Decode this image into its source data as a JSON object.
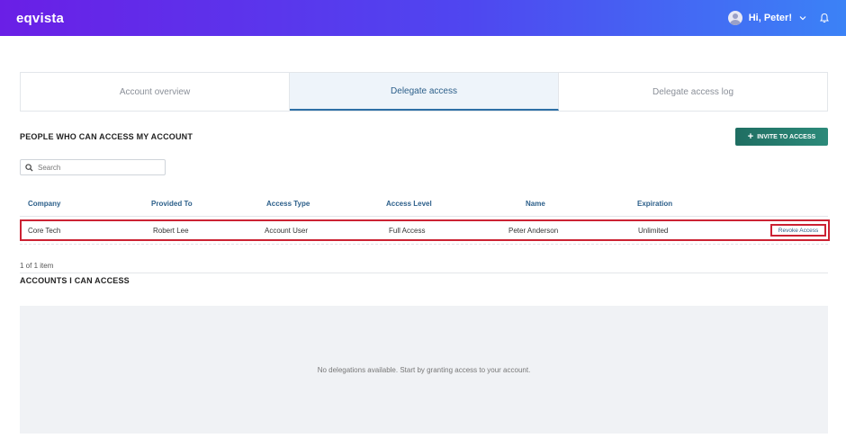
{
  "header": {
    "logo": "eqvista",
    "greeting": "Hi, Peter!"
  },
  "tabs": [
    {
      "label": "Account overview",
      "active": false
    },
    {
      "label": "Delegate access",
      "active": true
    },
    {
      "label": "Delegate access log",
      "active": false
    }
  ],
  "people_section": {
    "title": "PEOPLE WHO CAN ACCESS MY ACCOUNT",
    "invite_button": "INVITE TO ACCESS",
    "search_placeholder": "Search",
    "columns": [
      "Company",
      "Provided To",
      "Access Type",
      "Access Level",
      "Name",
      "Expiration"
    ],
    "rows": [
      {
        "company": "Core Tech",
        "provided_to": "Robert Lee",
        "access_type": "Account User",
        "access_level": "Full Access",
        "name": "Peter Anderson",
        "expiration": "Unlimited",
        "action": "Revoke Access"
      }
    ],
    "count": "1 of 1 item"
  },
  "accounts_section": {
    "title": "ACCOUNTS I CAN ACCESS",
    "empty_message": "No delegations available. Start by granting access to your account."
  },
  "colors": {
    "accent": "#2c5f8a",
    "invite_button": "#1f6e62",
    "highlight_border": "#cc2233"
  }
}
